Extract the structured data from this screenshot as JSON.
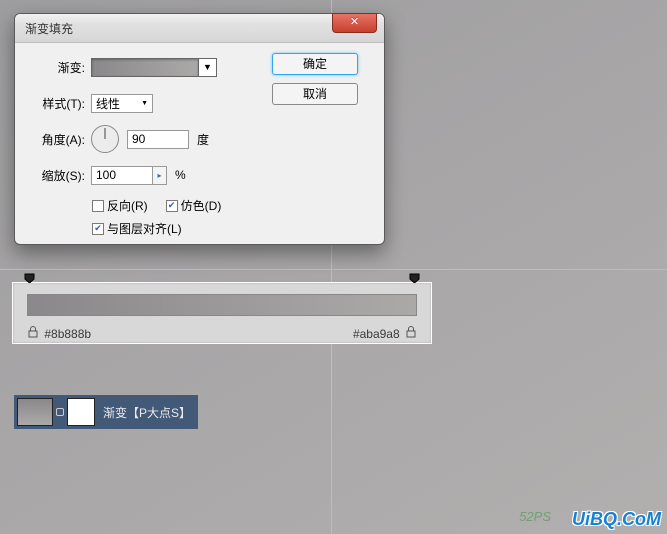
{
  "dialog": {
    "title": "渐变填充",
    "close_glyph": "✕",
    "ok_label": "确定",
    "cancel_label": "取消",
    "gradient_label": "渐变:",
    "style_label": "样式(T):",
    "style_value": "线性",
    "angle_label": "角度(A):",
    "angle_value": "90",
    "angle_unit": "度",
    "scale_label": "缩放(S):",
    "scale_value": "100",
    "scale_unit": "%",
    "reverse_label": "反向(R)",
    "dither_label": "仿色(D)",
    "align_label": "与图层对齐(L)",
    "reverse_checked": false,
    "dither_checked": true,
    "align_checked": true
  },
  "editor": {
    "left_hex": "#8b888b",
    "right_hex": "#aba9a8"
  },
  "layer": {
    "name": "渐变【P大点S】"
  },
  "watermark": {
    "main": "UiBQ.CoM",
    "sub": "52PS"
  },
  "chart_data": {
    "type": "gradient",
    "stops": [
      {
        "position": 0,
        "color": "#8b888b"
      },
      {
        "position": 100,
        "color": "#aba9a8"
      }
    ],
    "angle": 90,
    "scale": 100,
    "style": "linear",
    "reverse": false,
    "dither": true,
    "align_with_layer": true
  }
}
